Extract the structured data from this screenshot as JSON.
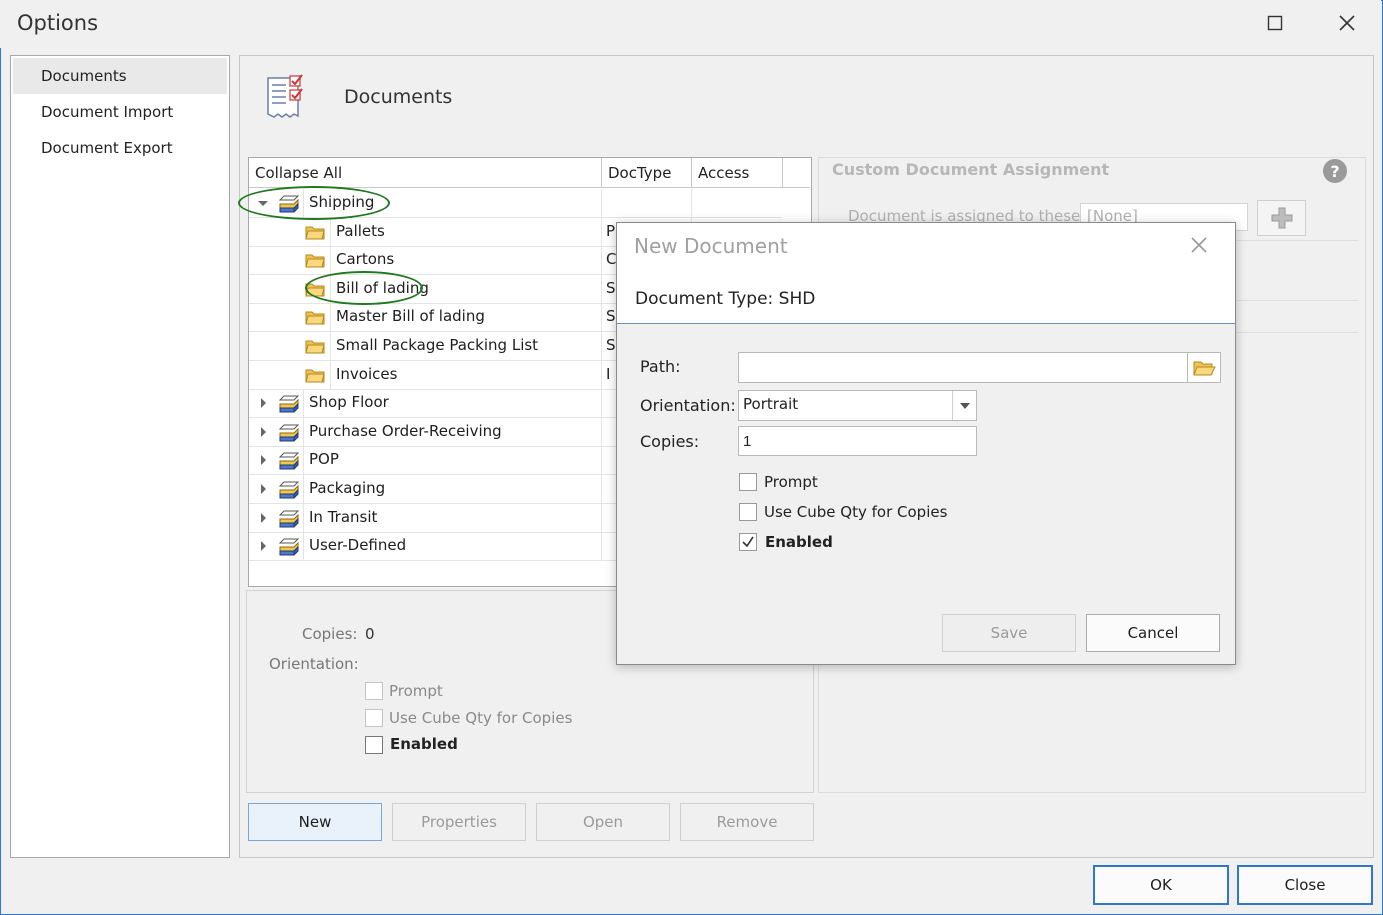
{
  "window": {
    "title": "Options",
    "maximize_icon": "maximize-icon",
    "close_icon": "close-icon"
  },
  "nav": {
    "items": [
      {
        "label": "Documents",
        "selected": true
      },
      {
        "label": "Document Import",
        "selected": false
      },
      {
        "label": "Document Export",
        "selected": false
      }
    ]
  },
  "header": {
    "title": "Documents",
    "icon": "documents-checklist-icon"
  },
  "grid": {
    "columns": [
      "Collapse All",
      "DocType",
      "Access"
    ],
    "rows": [
      {
        "label": "Shipping",
        "level": 0,
        "expanded": true,
        "doctype": "",
        "highlighted": true
      },
      {
        "label": "Pallets",
        "level": 1,
        "doctype": "P"
      },
      {
        "label": "Cartons",
        "level": 1,
        "doctype": "C"
      },
      {
        "label": "Bill of lading",
        "level": 1,
        "doctype": "S",
        "highlighted": true
      },
      {
        "label": "Master Bill of lading",
        "level": 1,
        "doctype": "S"
      },
      {
        "label": "Small Package Packing List",
        "level": 1,
        "doctype": "S"
      },
      {
        "label": "Invoices",
        "level": 1,
        "doctype": "I"
      },
      {
        "label": "Shop Floor",
        "level": 0,
        "expanded": false,
        "doctype": ""
      },
      {
        "label": "Purchase Order-Receiving",
        "level": 0,
        "expanded": false,
        "doctype": ""
      },
      {
        "label": "POP",
        "level": 0,
        "expanded": false,
        "doctype": ""
      },
      {
        "label": "Packaging",
        "level": 0,
        "expanded": false,
        "doctype": ""
      },
      {
        "label": "In Transit",
        "level": 0,
        "expanded": false,
        "doctype": ""
      },
      {
        "label": "User-Defined",
        "level": 0,
        "expanded": false,
        "doctype": ""
      }
    ],
    "annotation_color": "#1e7a1e"
  },
  "props": {
    "copies_label": "Copies:",
    "copies_value": "0",
    "orientation_label": "Orientation:",
    "prompt_label": "Prompt",
    "cube_label": "Use Cube Qty  for Copies",
    "enabled_label": "Enabled"
  },
  "buttons": {
    "new": "New",
    "properties": "Properties",
    "open": "Open",
    "remove": "Remove",
    "ok": "OK",
    "close": "Close"
  },
  "custom": {
    "title": "Custom Document Assignment",
    "assigned_label": "Document is assigned to these:",
    "assigned_value": "[None]",
    "help_icon": "?"
  },
  "dialog": {
    "title": "New Document",
    "doctype_text": "Document Type: SHD",
    "path_label": "Path:",
    "path_value": "",
    "orientation_label": "Orientation:",
    "orientation_value": "Portrait",
    "copies_label": "Copies:",
    "copies_value": "1",
    "prompt_label": "Prompt",
    "prompt_checked": false,
    "cube_label": "Use Cube Qty for Copies",
    "cube_checked": false,
    "enabled_label": "Enabled",
    "enabled_checked": true,
    "save_label": "Save",
    "cancel_label": "Cancel"
  },
  "colors": {
    "accent_border": "#2b78d6",
    "selected_nav": "#e9e9e9"
  }
}
